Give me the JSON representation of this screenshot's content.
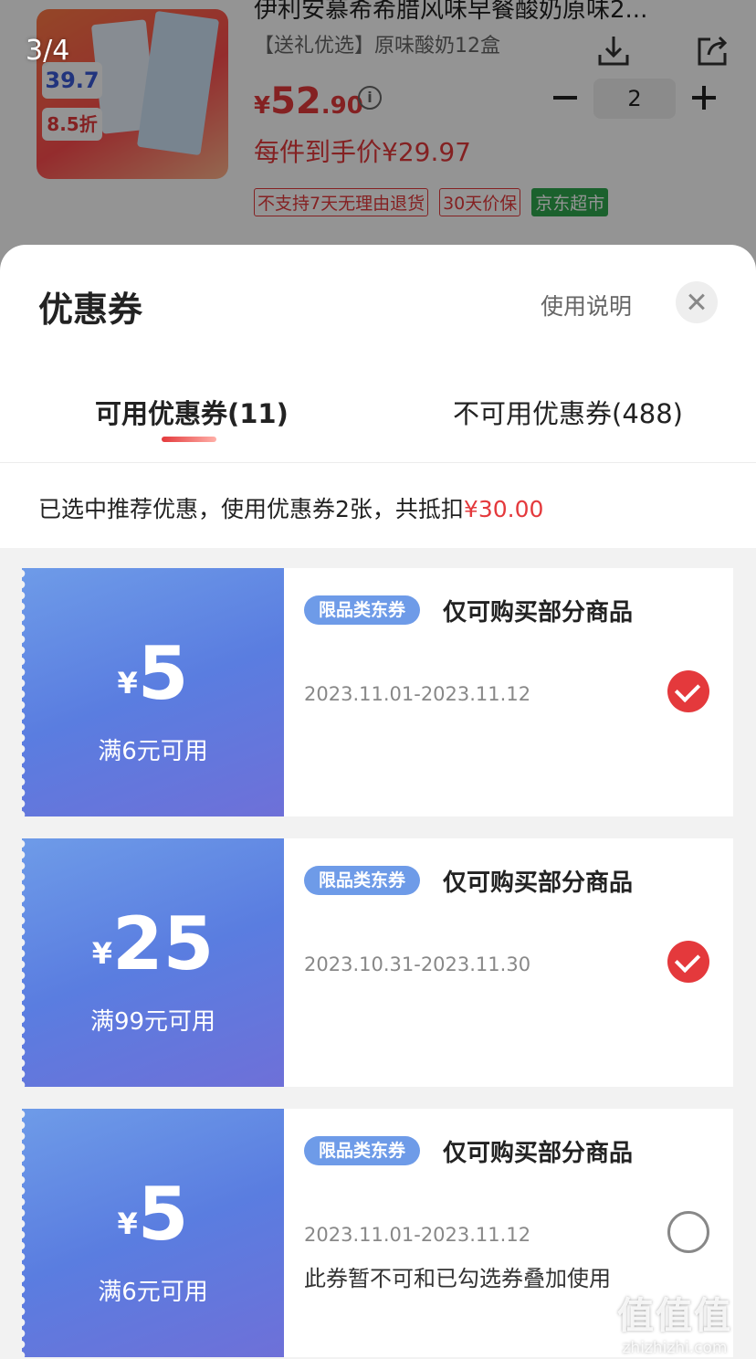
{
  "product": {
    "page_counter": "3/4",
    "title": "伊利安慕希希腊风味早餐酸奶原味2...",
    "subtitle": "【送礼优选】原味酸奶12盒",
    "image_tag_price": "39.7",
    "image_tag_discount": "8.5折",
    "price_currency": "¥",
    "price_integer": "52",
    "price_decimal": ".90",
    "quantity": "2",
    "unit_price": "每件到手价¥29.97",
    "tags": [
      "不支持7天无理由退货",
      "30天价保",
      "京东超市"
    ],
    "icons": {
      "download": "download-icon",
      "share": "share-icon",
      "info": "info-icon"
    }
  },
  "sheet": {
    "title": "优惠券",
    "usage_link": "使用说明",
    "tabs": [
      {
        "label": "可用优惠券(11)",
        "active": true
      },
      {
        "label": "不可用优惠券(488)",
        "active": false
      }
    ],
    "summary_prefix": "已选中推荐优惠，使用优惠券2张，共抵扣",
    "summary_amount": "¥30.00"
  },
  "coupons": [
    {
      "currency": "¥",
      "amount": "5",
      "condition": "满6元可用",
      "badge": "限品类东券",
      "name": "仅可购买部分商品",
      "validity": "2023.11.01-2023.11.12",
      "note": "",
      "selected": true
    },
    {
      "currency": "¥",
      "amount": "25",
      "condition": "满99元可用",
      "badge": "限品类东券",
      "name": "仅可购买部分商品",
      "validity": "2023.10.31-2023.11.30",
      "note": "",
      "selected": true
    },
    {
      "currency": "¥",
      "amount": "5",
      "condition": "满6元可用",
      "badge": "限品类东券",
      "name": "仅可购买部分商品",
      "validity": "2023.11.01-2023.11.12",
      "note": "此券暂不可和已勾选券叠加使用",
      "selected": false
    }
  ],
  "colors": {
    "accent": "#e4393c",
    "coupon_blue": "#6e9be8",
    "green_tag": "#2fa84f"
  },
  "watermark": {
    "main": "值值值",
    "url": "zhizhizhi.com"
  }
}
